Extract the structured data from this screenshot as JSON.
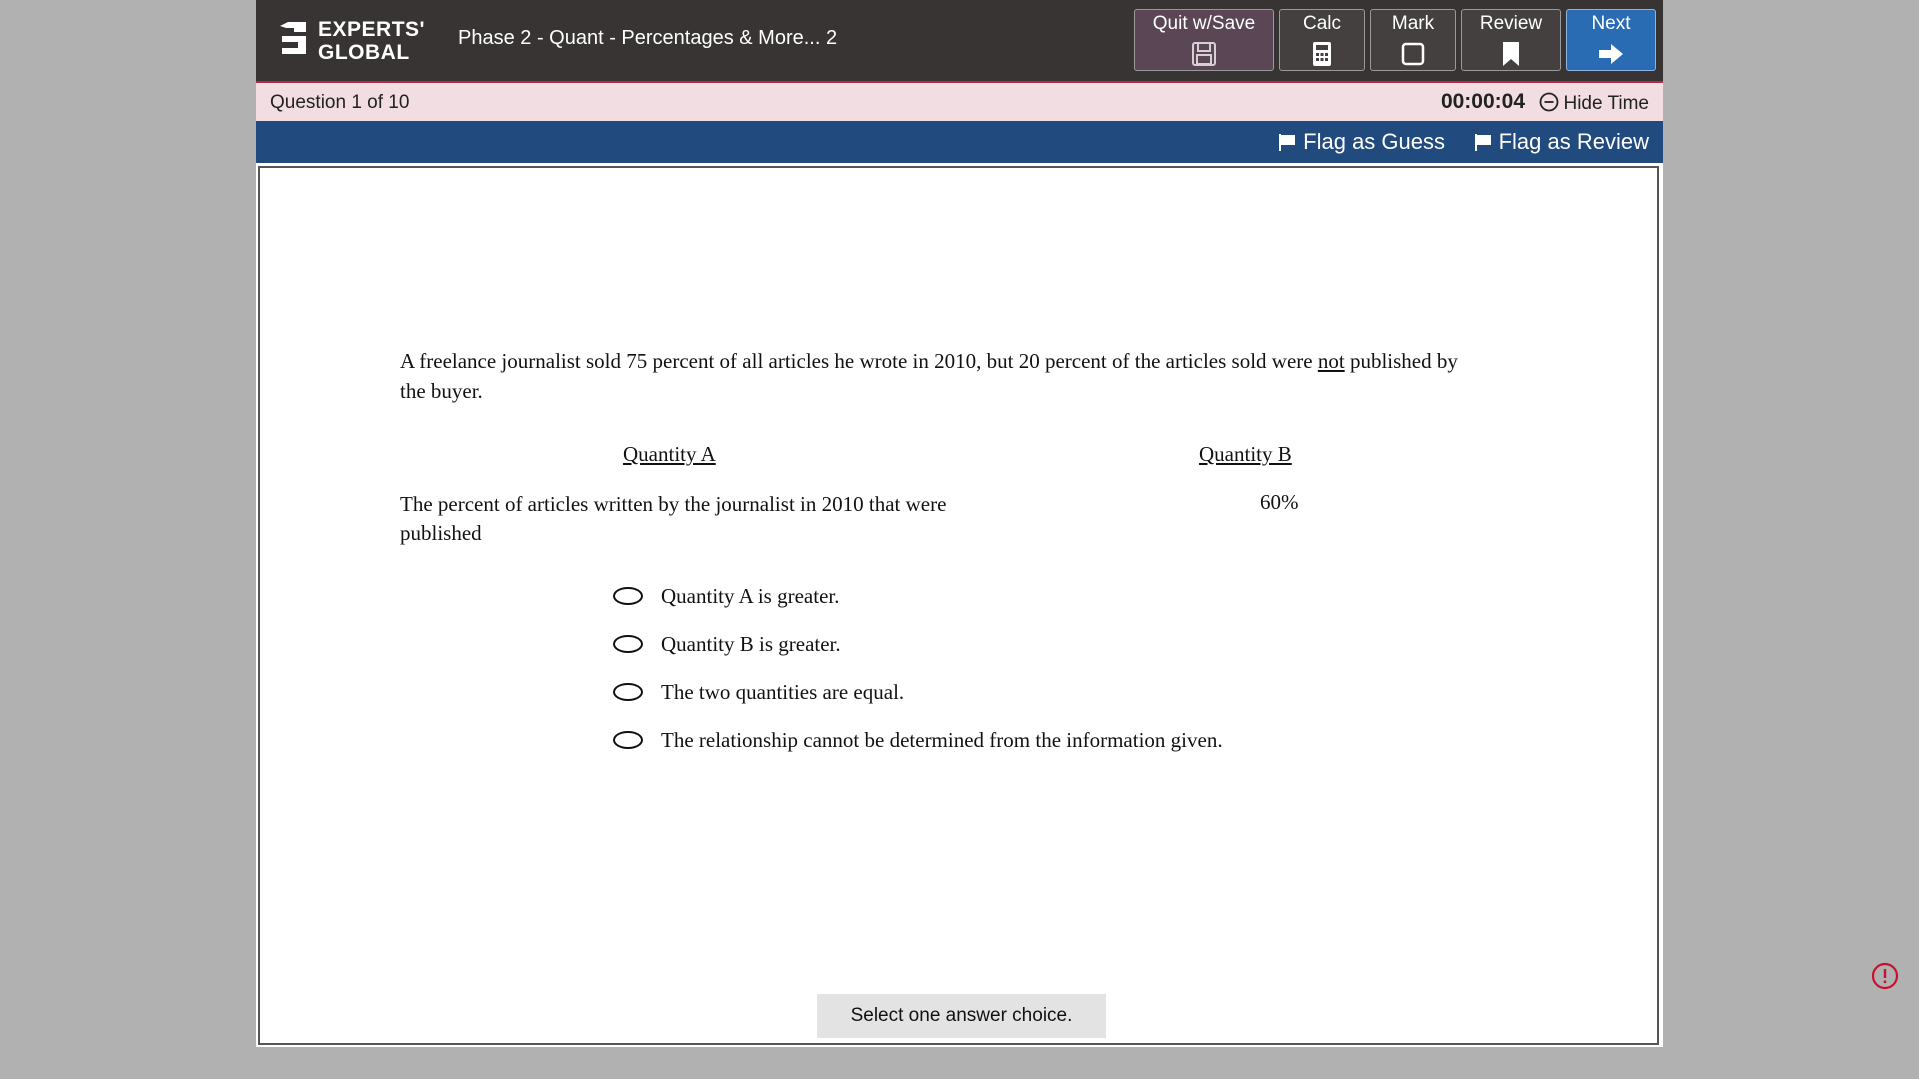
{
  "header": {
    "logo_line1": "EXPERTS'",
    "logo_line2": "GLOBAL",
    "title": "Phase 2 - Quant - Percentages & More... 2"
  },
  "toolbar": {
    "quit_label": "Quit w/Save",
    "calc_label": "Calc",
    "mark_label": "Mark",
    "review_label": "Review",
    "next_label": "Next"
  },
  "question_bar": {
    "counter": "Question  1 of 10",
    "timer": "00:00:04",
    "hide_time_label": "Hide Time"
  },
  "flag_bar": {
    "flag_guess_label": "Flag as Guess",
    "flag_review_label": "Flag as Review"
  },
  "question": {
    "stem_before": "A freelance journalist sold 75 percent of all articles he wrote in 2010, but 20 percent of the articles sold were ",
    "stem_underlined": "not",
    "stem_after": " published by the buyer.",
    "quantity_a_heading": "Quantity A",
    "quantity_b_heading": "Quantity B",
    "quantity_a_text": "The percent of articles written by the journalist in 2010 that were published",
    "quantity_b_text": "60%",
    "choices": [
      "Quantity A is greater.",
      "Quantity B is greater.",
      "The two quantities are equal.",
      "The relationship cannot be determined from the information given."
    ],
    "instruction": "Select one answer choice."
  },
  "colors": {
    "header_bg": "#383434",
    "question_bar_bg": "#f1dde2",
    "flag_bar_bg": "#214a7e",
    "next_button_bg": "#2a6cb3",
    "alert_red": "#c8102e"
  }
}
